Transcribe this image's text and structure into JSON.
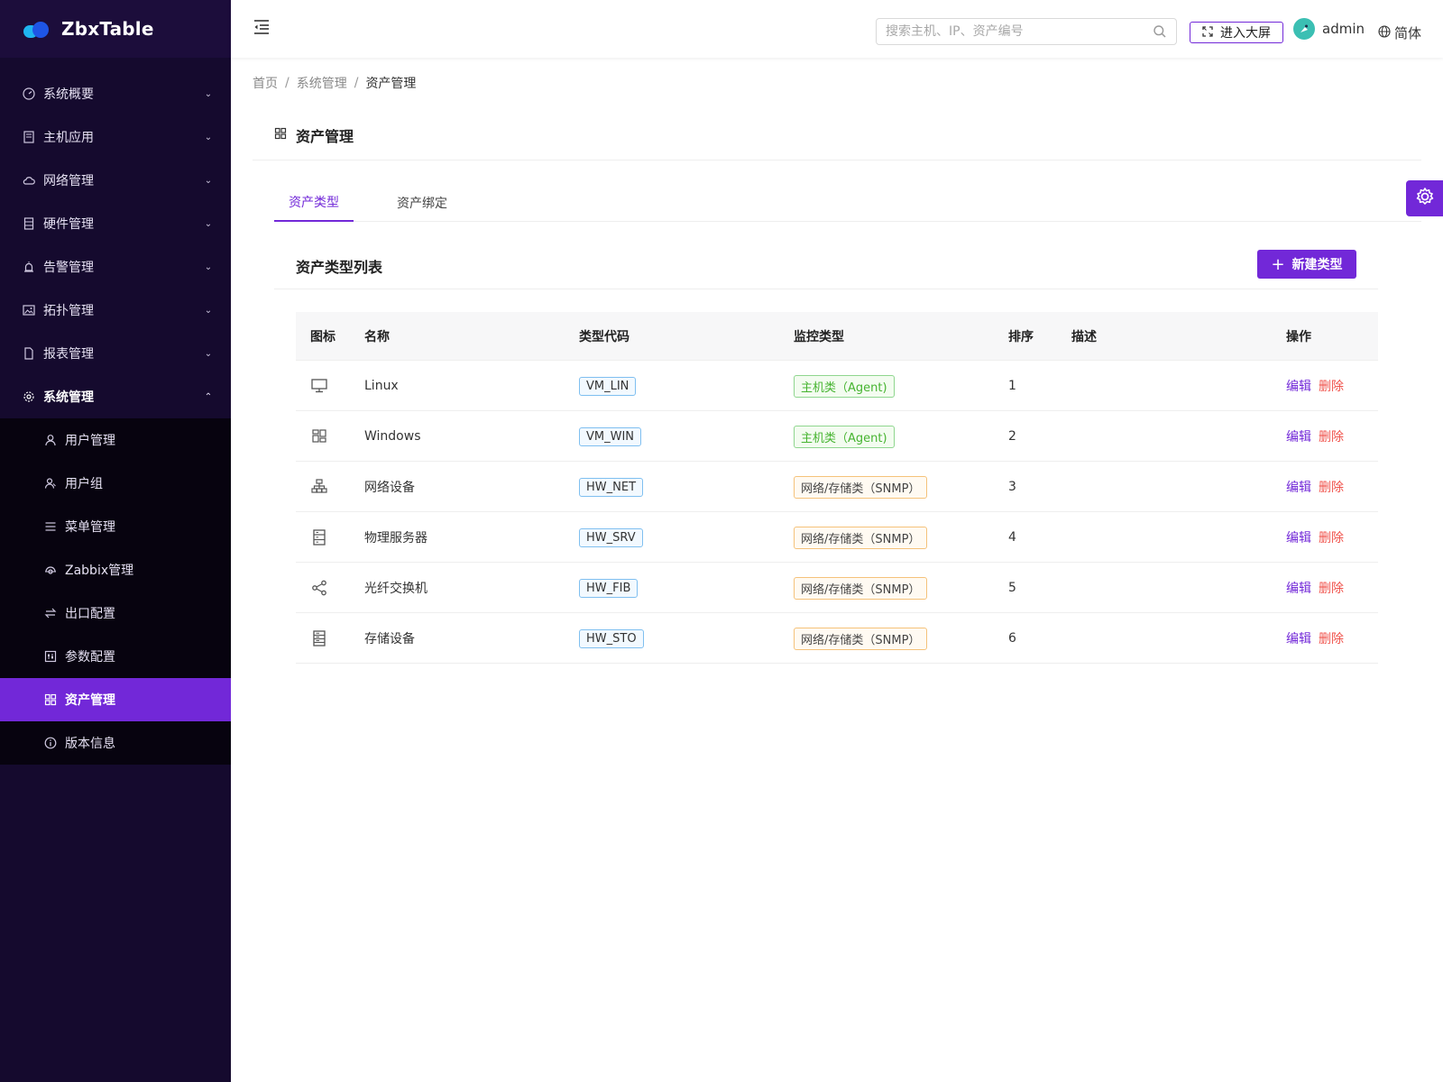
{
  "app": {
    "name": "ZbxTable"
  },
  "sidebar": {
    "items": [
      {
        "label": "系统概要",
        "icon": "dashboard-icon"
      },
      {
        "label": "主机应用",
        "icon": "host-icon"
      },
      {
        "label": "网络管理",
        "icon": "cloud-icon"
      },
      {
        "label": "硬件管理",
        "icon": "hardware-icon"
      },
      {
        "label": "告警管理",
        "icon": "alarm-icon"
      },
      {
        "label": "拓扑管理",
        "icon": "image-icon"
      },
      {
        "label": "报表管理",
        "icon": "file-icon"
      },
      {
        "label": "系统管理",
        "icon": "gear-icon"
      }
    ],
    "subitems": [
      {
        "label": "用户管理",
        "icon": "user-icon"
      },
      {
        "label": "用户组",
        "icon": "usergroup-icon"
      },
      {
        "label": "菜单管理",
        "icon": "menu-icon"
      },
      {
        "label": "Zabbix管理",
        "icon": "api-icon"
      },
      {
        "label": "出口配置",
        "icon": "swap-icon"
      },
      {
        "label": "参数配置",
        "icon": "control-icon"
      },
      {
        "label": "资产管理",
        "icon": "appstore-icon"
      },
      {
        "label": "版本信息",
        "icon": "info-icon"
      }
    ]
  },
  "header": {
    "search_placeholder": "搜索主机、IP、资产编号",
    "bigscreen_label": "进入大屏",
    "username": "admin",
    "language": "简体"
  },
  "breadcrumb": {
    "items": [
      "首页",
      "系统管理",
      "资产管理"
    ]
  },
  "page": {
    "title": "资产管理"
  },
  "tabs": [
    "资产类型",
    "资产绑定"
  ],
  "card": {
    "title": "资产类型列表",
    "new_button": "新建类型"
  },
  "table": {
    "columns": [
      "图标",
      "名称",
      "类型代码",
      "监控类型",
      "排序",
      "描述",
      "操作"
    ],
    "rows": [
      {
        "icon": "desktop-icon",
        "name": "Linux",
        "code": "VM_LIN",
        "monitor": "主机类（Agent)",
        "monitor_kind": "agent",
        "order": "1",
        "desc": ""
      },
      {
        "icon": "windows-icon",
        "name": "Windows",
        "code": "VM_WIN",
        "monitor": "主机类（Agent)",
        "monitor_kind": "agent",
        "order": "2",
        "desc": ""
      },
      {
        "icon": "cluster-icon",
        "name": "网络设备",
        "code": "HW_NET",
        "monitor": "网络/存储类（SNMP）",
        "monitor_kind": "snmp",
        "order": "3",
        "desc": ""
      },
      {
        "icon": "server-icon",
        "name": "物理服务器",
        "code": "HW_SRV",
        "monitor": "网络/存储类（SNMP）",
        "monitor_kind": "snmp",
        "order": "4",
        "desc": ""
      },
      {
        "icon": "share-icon",
        "name": "光纤交换机",
        "code": "HW_FIB",
        "monitor": "网络/存储类（SNMP）",
        "monitor_kind": "snmp",
        "order": "5",
        "desc": ""
      },
      {
        "icon": "storage-icon",
        "name": "存储设备",
        "code": "HW_STO",
        "monitor": "网络/存储类（SNMP）",
        "monitor_kind": "snmp",
        "order": "6",
        "desc": ""
      }
    ],
    "edit_label": "编辑",
    "delete_label": "删除"
  },
  "colors": {
    "accent": "#7228d8",
    "sidebar_bg": "#150a2e",
    "submenu_bg": "#07030f",
    "danger": "#f0524b"
  }
}
